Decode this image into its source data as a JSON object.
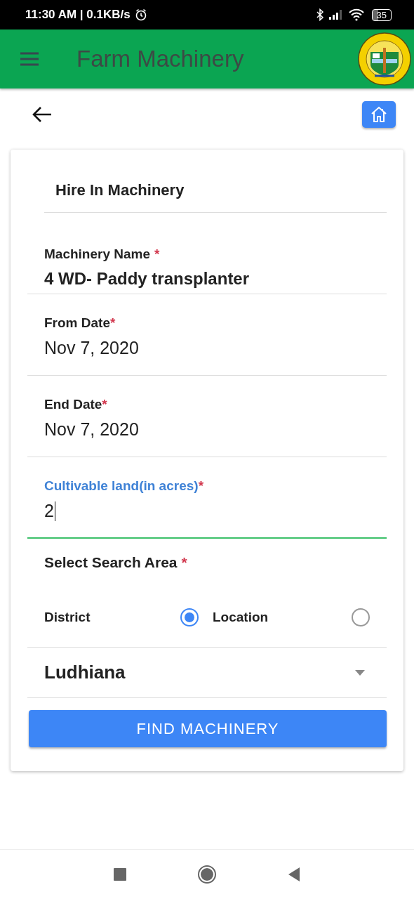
{
  "status_bar": {
    "info": "11:30 AM | 0.1KB/s",
    "battery": "35"
  },
  "app_bar": {
    "title": "Farm Machinery"
  },
  "form": {
    "title": "Hire In Machinery",
    "fields": [
      {
        "kind": "select",
        "label": "Machinery Name",
        "mark": "*",
        "value": "4 WD- Paddy transplanter",
        "focused": false
      },
      {
        "kind": "date",
        "label": "From Date",
        "mark": "*",
        "value": "Nov 7, 2020",
        "focused": false
      },
      {
        "kind": "date",
        "label": "End Date",
        "mark": "*",
        "value": "Nov 7, 2020",
        "focused": false
      },
      {
        "kind": "input",
        "label": "Cultivable land(in acres)",
        "mark": "*",
        "value": "2",
        "focused": true
      }
    ],
    "search_area": {
      "label": "Select Search Area",
      "mark": "*",
      "options": [
        {
          "label": "District",
          "selected": true
        },
        {
          "label": "Location",
          "selected": false
        }
      ]
    },
    "area_dropdown": {
      "value": "Ludhiana"
    },
    "submit_button": "FIND MACHINERY"
  }
}
